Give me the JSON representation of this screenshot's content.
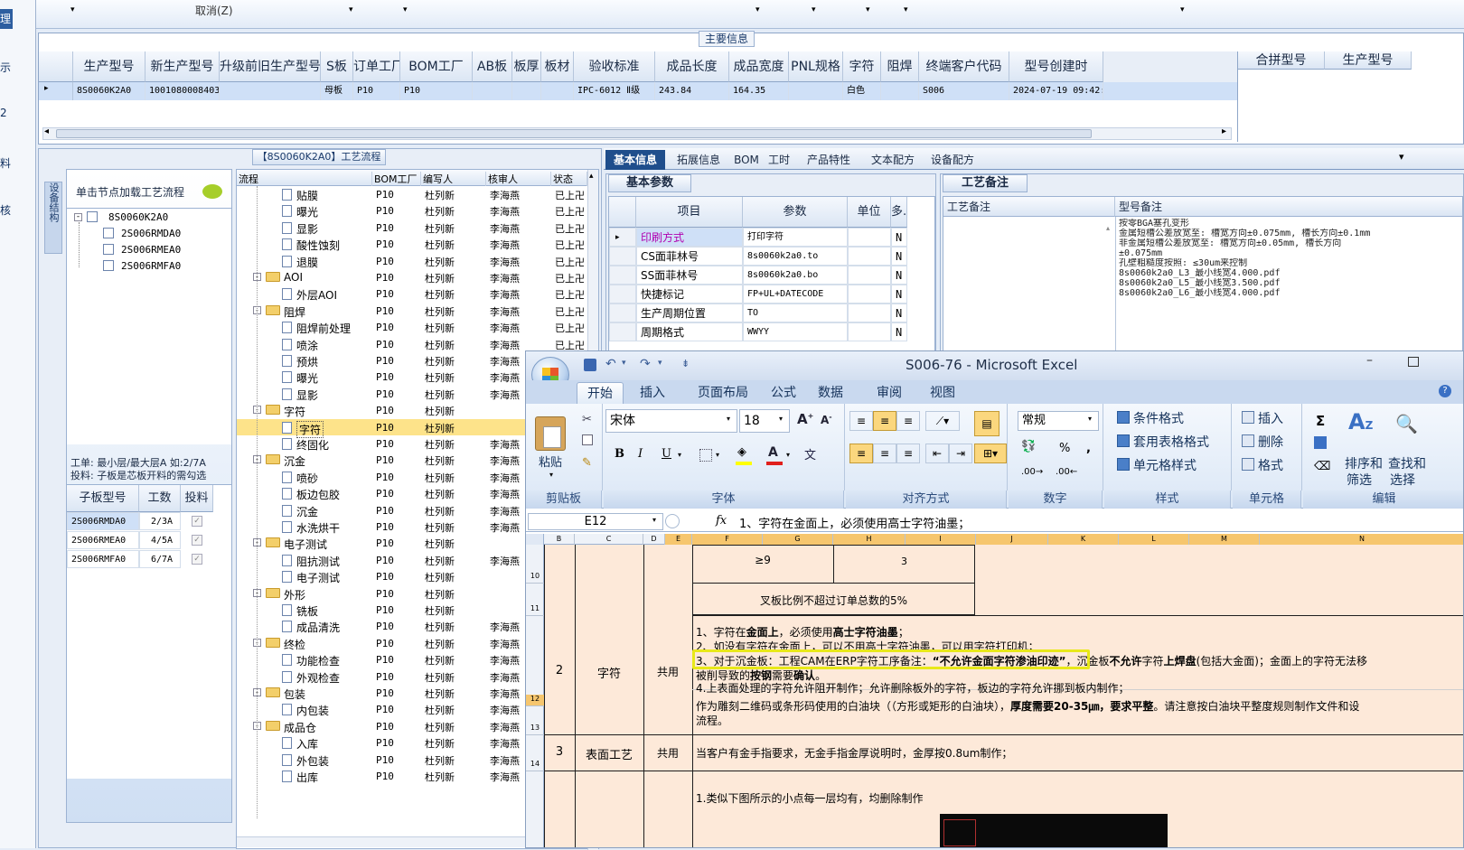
{
  "left_strip": {
    "items": [
      "理",
      "示",
      "2",
      "料",
      "核"
    ]
  },
  "top_bar": {
    "cancel": "取消(Z)"
  },
  "main_info": {
    "title": "主要信息",
    "columns": [
      "生产型号",
      "新生产型号",
      "升级前旧生产型号",
      "S板",
      "订单工厂",
      "BOM工厂",
      "AB板",
      "板厚",
      "板材",
      "验收标准",
      "成品长度",
      "成品宽度",
      "PNL规格",
      "字符",
      "阻焊",
      "终端客户代码",
      "型号创建时"
    ],
    "row": [
      "8S0060K2A0",
      "10010800084031",
      "",
      "母板",
      "P10",
      "P10",
      "",
      "",
      "",
      "IPC-6012 Ⅱ级",
      "243.84",
      "164.35",
      "",
      "白色",
      "",
      "S006",
      "2024-07-19 09:42:07"
    ],
    "right_columns": [
      "合拼型号",
      "生产型号"
    ]
  },
  "process_panel": {
    "title": "【8S0060K2A0】工艺流程",
    "side_tab": "设备结构",
    "load_hint": "单击节点加载工艺流程",
    "tree_root": "8S0060K2A0",
    "tree_children": [
      "2S006RMDA0",
      "2S006RMEA0",
      "2S006RMFA0"
    ],
    "info_text_1": "工单: 最小层/最大层A 如:2/7A",
    "info_text_2": "投料: 子板是芯板开料的需勾选",
    "sub_columns": [
      "子板型号",
      "工数",
      "投料"
    ],
    "sub_rows": [
      [
        "2S006RMDA0",
        "2/3A"
      ],
      [
        "2S006RMEA0",
        "4/5A"
      ],
      [
        "2S006RMFA0",
        "6/7A"
      ]
    ],
    "flow_columns": [
      "流程",
      "BOM工厂",
      "编写人",
      "核审人",
      "状态"
    ],
    "flow_rows": [
      {
        "name": "贴膜",
        "folder": false,
        "level": 2,
        "factory": "P10",
        "writer": "杜列新",
        "reviewer": "李海燕",
        "status": "已上卍"
      },
      {
        "name": "曝光",
        "folder": false,
        "level": 2,
        "factory": "P10",
        "writer": "杜列新",
        "reviewer": "李海燕",
        "status": "已上卍"
      },
      {
        "name": "显影",
        "folder": false,
        "level": 2,
        "factory": "P10",
        "writer": "杜列新",
        "reviewer": "李海燕",
        "status": "已上卍"
      },
      {
        "name": "酸性蚀刻",
        "folder": false,
        "level": 2,
        "factory": "P10",
        "writer": "杜列新",
        "reviewer": "李海燕",
        "status": "已上卍"
      },
      {
        "name": "退膜",
        "folder": false,
        "level": 2,
        "factory": "P10",
        "writer": "杜列新",
        "reviewer": "李海燕",
        "status": "已上卍"
      },
      {
        "name": "AOI",
        "folder": true,
        "level": 1,
        "factory": "P10",
        "writer": "杜列新",
        "reviewer": "李海燕",
        "status": "已上卍"
      },
      {
        "name": "外层AOI",
        "folder": false,
        "level": 2,
        "factory": "P10",
        "writer": "杜列新",
        "reviewer": "李海燕",
        "status": "已上卍"
      },
      {
        "name": "阻焊",
        "folder": true,
        "level": 1,
        "factory": "P10",
        "writer": "杜列新",
        "reviewer": "李海燕",
        "status": "已上卍"
      },
      {
        "name": "阻焊前处理",
        "folder": false,
        "level": 2,
        "factory": "P10",
        "writer": "杜列新",
        "reviewer": "李海燕",
        "status": "已上卍"
      },
      {
        "name": "喷涂",
        "folder": false,
        "level": 2,
        "factory": "P10",
        "writer": "杜列新",
        "reviewer": "李海燕",
        "status": "已上卍"
      },
      {
        "name": "预烘",
        "folder": false,
        "level": 2,
        "factory": "P10",
        "writer": "杜列新",
        "reviewer": "李海燕",
        "status": ""
      },
      {
        "name": "曝光",
        "folder": false,
        "level": 2,
        "factory": "P10",
        "writer": "杜列新",
        "reviewer": "李海燕",
        "status": ""
      },
      {
        "name": "显影",
        "folder": false,
        "level": 2,
        "factory": "P10",
        "writer": "杜列新",
        "reviewer": "李海燕",
        "status": ""
      },
      {
        "name": "字符",
        "folder": true,
        "level": 1,
        "factory": "P10",
        "writer": "杜列新",
        "reviewer": "",
        "status": ""
      },
      {
        "name": "字符",
        "folder": false,
        "level": 2,
        "factory": "P10",
        "writer": "杜列新",
        "reviewer": "",
        "status": "",
        "selected": true
      },
      {
        "name": "终固化",
        "folder": false,
        "level": 2,
        "factory": "P10",
        "writer": "杜列新",
        "reviewer": "李海燕",
        "status": ""
      },
      {
        "name": "沉金",
        "folder": true,
        "level": 1,
        "factory": "P10",
        "writer": "杜列新",
        "reviewer": "李海燕",
        "status": ""
      },
      {
        "name": "喷砂",
        "folder": false,
        "level": 2,
        "factory": "P10",
        "writer": "杜列新",
        "reviewer": "李海燕",
        "status": ""
      },
      {
        "name": "板边包胶",
        "folder": false,
        "level": 2,
        "factory": "P10",
        "writer": "杜列新",
        "reviewer": "李海燕",
        "status": ""
      },
      {
        "name": "沉金",
        "folder": false,
        "level": 2,
        "factory": "P10",
        "writer": "杜列新",
        "reviewer": "李海燕",
        "status": ""
      },
      {
        "name": "水洗烘干",
        "folder": false,
        "level": 2,
        "factory": "P10",
        "writer": "杜列新",
        "reviewer": "李海燕",
        "status": ""
      },
      {
        "name": "电子测试",
        "folder": true,
        "level": 1,
        "factory": "P10",
        "writer": "杜列新",
        "reviewer": "",
        "status": ""
      },
      {
        "name": "阻抗测试",
        "folder": false,
        "level": 2,
        "factory": "P10",
        "writer": "杜列新",
        "reviewer": "李海燕",
        "status": ""
      },
      {
        "name": "电子测试",
        "folder": false,
        "level": 2,
        "factory": "P10",
        "writer": "杜列新",
        "reviewer": "",
        "status": ""
      },
      {
        "name": "外形",
        "folder": true,
        "level": 1,
        "factory": "P10",
        "writer": "杜列新",
        "reviewer": "",
        "status": ""
      },
      {
        "name": "铣板",
        "folder": false,
        "level": 2,
        "factory": "P10",
        "writer": "杜列新",
        "reviewer": "",
        "status": ""
      },
      {
        "name": "成品清洗",
        "folder": false,
        "level": 2,
        "factory": "P10",
        "writer": "杜列新",
        "reviewer": "李海燕",
        "status": ""
      },
      {
        "name": "终检",
        "folder": true,
        "level": 1,
        "factory": "P10",
        "writer": "杜列新",
        "reviewer": "李海燕",
        "status": ""
      },
      {
        "name": "功能检查",
        "folder": false,
        "level": 2,
        "factory": "P10",
        "writer": "杜列新",
        "reviewer": "李海燕",
        "status": ""
      },
      {
        "name": "外观检查",
        "folder": false,
        "level": 2,
        "factory": "P10",
        "writer": "杜列新",
        "reviewer": "李海燕",
        "status": ""
      },
      {
        "name": "包装",
        "folder": true,
        "level": 1,
        "factory": "P10",
        "writer": "杜列新",
        "reviewer": "李海燕",
        "status": ""
      },
      {
        "name": "内包装",
        "folder": false,
        "level": 2,
        "factory": "P10",
        "writer": "杜列新",
        "reviewer": "李海燕",
        "status": ""
      },
      {
        "name": "成品仓",
        "folder": true,
        "level": 1,
        "factory": "P10",
        "writer": "杜列新",
        "reviewer": "李海燕",
        "status": ""
      },
      {
        "name": "入库",
        "folder": false,
        "level": 2,
        "factory": "P10",
        "writer": "杜列新",
        "reviewer": "李海燕",
        "status": ""
      },
      {
        "name": "外包装",
        "folder": false,
        "level": 2,
        "factory": "P10",
        "writer": "杜列新",
        "reviewer": "李海燕",
        "status": ""
      },
      {
        "name": "出库",
        "folder": false,
        "level": 2,
        "factory": "P10",
        "writer": "杜列新",
        "reviewer": "李海燕",
        "status": ""
      }
    ]
  },
  "detail_tabs": [
    "基本信息",
    "拓展信息",
    "BOM",
    "工时",
    "产品特性",
    "文本配方",
    "设备配方"
  ],
  "basic_params": {
    "title": "基本参数",
    "columns": [
      "项目",
      "参数",
      "单位",
      "多.."
    ],
    "rows": [
      [
        "印刷方式",
        "打印字符",
        "",
        "N"
      ],
      [
        "CS面菲林号",
        "8s0060k2a0.to",
        "",
        "N"
      ],
      [
        "SS面菲林号",
        "8s0060k2a0.bo",
        "",
        "N"
      ],
      [
        "快捷标记",
        "FP+UL+DATECODE",
        "",
        "N"
      ],
      [
        "生产周期位置",
        "TO",
        "",
        "N"
      ],
      [
        "周期格式",
        "WWYY",
        "",
        "N"
      ]
    ]
  },
  "process_notes": {
    "title": "工艺备注",
    "columns": [
      "工艺备注",
      "型号备注"
    ],
    "model_notes": [
      "按零BGA塞孔变形",
      "金属短槽公差放宽至: 槽宽方向±0.075mm, 槽长方向±0.1mm",
      "非金属短槽公差放宽至: 槽宽方向±0.05mm, 槽长方向",
      "±0.075mm",
      "孔壁粗糙度按照: ≤30um来控制",
      "8s0060k2a0_L3_最小线宽4.000.pdf",
      "8s0060k2a0_L5_最小线宽3.500.pdf",
      "8s0060k2a0_L6_最小线宽4.000.pdf"
    ]
  },
  "excel": {
    "title": "S006-76 - Microsoft Excel",
    "tabs": [
      "开始",
      "插入",
      "页面布局",
      "公式",
      "数据",
      "审阅",
      "视图"
    ],
    "paste": "粘贴",
    "groups": [
      "剪贴板",
      "字体",
      "对齐方式",
      "数字",
      "样式",
      "单元格",
      "编辑"
    ],
    "font_name": "宋体",
    "font_size": "18",
    "number_format": "常规",
    "style_items": [
      "条件格式",
      "套用表格格式",
      "单元格样式"
    ],
    "cell_items": [
      "插入",
      "删除",
      "格式"
    ],
    "edit_items": [
      "排序和",
      "筛选",
      "查找和",
      "选择"
    ],
    "name_box": "E12",
    "fx": "fx",
    "formula": "1、字符在金面上，必须使用高士字符油墨；",
    "col_letters": [
      "B",
      "C",
      "D",
      "E",
      "F",
      "G",
      "H",
      "I",
      "J",
      "K",
      "L",
      "M",
      "N"
    ],
    "row_nums": [
      "10",
      "11",
      "12",
      "13",
      "14"
    ],
    "cells": {
      "r10_e": "≥9",
      "r10_g": "3",
      "r11": "叉板比例不超过订单总数的5%",
      "r12_b": "2",
      "r12_c": "字符",
      "r12_d": "共用",
      "line1a": "1、字符在",
      "line1b": "金面上",
      "line1c": "，必须使用",
      "line1d": "高士字符油墨",
      "line1e": "；",
      "line2": "2、如没有字符在金面上，可以不用高士字符油墨，可以用字符打印机；",
      "line3a": "3、对于沉金板：工程CAM在ERP字符工序备注：",
      "line3b": "“不允许金面字符渗油印迹”",
      "line3c": "，沉金板",
      "line3d": "不允许",
      "line3e": "字符",
      "line3f": "上焊盘",
      "line3g": "(包括大金面)；金面上的字符无法移",
      "line3h": "被削导致的",
      "line3i": "按钢",
      "line3j": "需要",
      "line3k": "确认",
      "line3l": "。",
      "line4": "4.上表面处理的字符允许阻开制作；允许删除板外的字符，板边的字符允许挪到板内制作；",
      "line5a": "作为雕刻二维码或条形码使用的白油块（（方形或矩形的白油块），",
      "line5b": "厚度需要20-35㎛，要求平整",
      "line5c": "。请注意按白油块平整度规则制作文件和设",
      "line5d": "流程。",
      "r14_b": "3",
      "r14_c": "表面工艺",
      "r14_d": "共用",
      "r14_e": "当客户有金手指要求，无金手指金厚说明时，金厚按0.8um制作；",
      "r15_e": "1.类似下图所示的小点每一层均有，均删除制作"
    }
  },
  "colors": {
    "accent_blue": "#1f4e8c",
    "selection": "#cfe0f7",
    "highlight_row": "#fde38a",
    "excel_cell_bg": "#fde9d9",
    "yellow_box": "#e8e81a"
  }
}
